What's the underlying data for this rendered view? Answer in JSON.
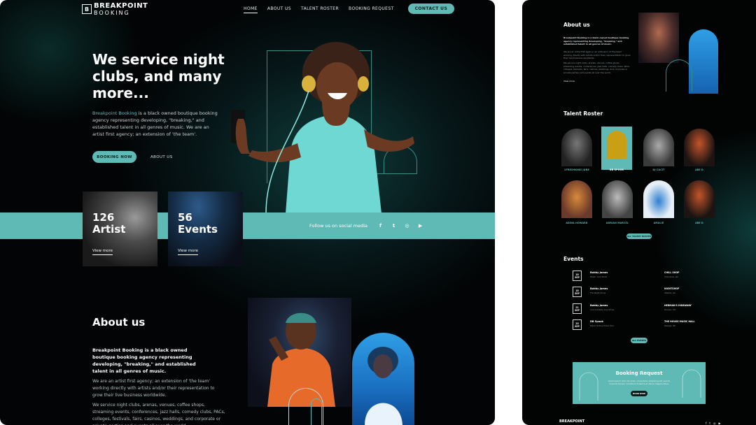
{
  "brand": {
    "logo_top": "BREAKPOINT",
    "logo_bottom": "BOOKING",
    "accent": "#5fb9b4",
    "bg": "#020405"
  },
  "nav": {
    "items": [
      "HOME",
      "ABOUT US",
      "TALENT ROSTER",
      "BOOKING REQUEST"
    ],
    "cta": "CONTACT US"
  },
  "hero": {
    "title": "We service night clubs, and many more...",
    "desc_accent": "Breakpoint Booking",
    "desc_rest": " is a black owned boutique booking agency representing developing, \"breaking,\" and established talent in all genres of music. We are an artist first agency; an extension of 'the team'.",
    "btn_book": "BOOKING NOW",
    "btn_about": "ABOUT US"
  },
  "stats": [
    {
      "count": "126",
      "label": "Artist",
      "more": "View more"
    },
    {
      "count": "56",
      "label": "Events",
      "more": "View more"
    }
  ],
  "social": {
    "label": "Follow us on social media",
    "icons": [
      "facebook-icon",
      "twitter-icon",
      "instagram-icon",
      "youtube-icon"
    ],
    "glyphs": [
      "f",
      "t",
      "◎",
      "▶"
    ]
  },
  "about": {
    "title": "About us",
    "p1": "Breakpoint Booking is a black owned boutique booking agency representing developing, \"breaking,\" and established talent in all genres of music.",
    "p2": "We are an artist first agency; an extension of 'the team' working directly with artists and/or their representation to grow their live business worldwide.",
    "p3": "We service night clubs, arenas, venues, coffee shops, streaming events, conferences, jazz halls, comedy clubs, PACs, colleges, festivals, fairs, casinos, weddings, and corporate or private parties and events all over the world."
  },
  "mobile": {
    "about_title": "About us",
    "about_text": "Breakpoint Booking is a black owned boutique booking agency representing developing, \"breaking,\" and established talent in all genres of music.",
    "about_text2": "We are an artist first agency; an extension of 'the team' working directly with artists and/or their representation to grow their live business worldwide.",
    "about_text3": "We service night clubs, arenas, venues, coffee shops, streaming events, conferences, jazz halls, comedy clubs, PACs, colleges, festivals, fairs, casinos, weddings, and corporate or private parties and events all over the world.",
    "view_more": "View more",
    "talent_title": "Talent Roster",
    "talents": [
      "2FRESHKING JUNE",
      "DB SPOOK",
      "DJ CACIT",
      "ABE D",
      "ADINA HOWARD",
      "ADRIAN MARCEL",
      "AMALIE",
      "ABE D"
    ],
    "all_talent": "ALL TALENT ROSTER",
    "events_title": "Events",
    "events": [
      {
        "day": "18",
        "month": "SEP",
        "name": "Bobby James",
        "sub": "Feelin' Line Show",
        "venue": "CHILL SHOP",
        "loc": "Columbus, GA"
      },
      {
        "day": "18",
        "month": "SEP",
        "name": "Bobby James",
        "sub": "The Night Show",
        "venue": "NIGHTSHOP",
        "loc": "Atlanta, GA"
      },
      {
        "day": "21",
        "month": "SEP",
        "name": "Bobby James",
        "sub": "Concert Party Live Show",
        "venue": "HERMAN'S HIDEAWAY",
        "loc": "Denver, CO"
      },
      {
        "day": "25",
        "month": "SEP",
        "name": "DB Spook",
        "sub": "Black History Music Tour",
        "venue": "THE HOUSE MUSIC HALL",
        "loc": "Raleigh, NC"
      }
    ],
    "all_events": "ALL EVENTS",
    "booking_title": "Booking Request",
    "booking_text": "Lorem ipsum dolor sit amet, consectetur adipiscing elit, sed do eiusmod tempor incididunt ut labore et dolore magna aliqua.",
    "booking_btn": "BOOK NOW",
    "footer_logo": "BREAKPOINT",
    "footer_icons": [
      "f",
      "t",
      "◎",
      "▶"
    ]
  }
}
